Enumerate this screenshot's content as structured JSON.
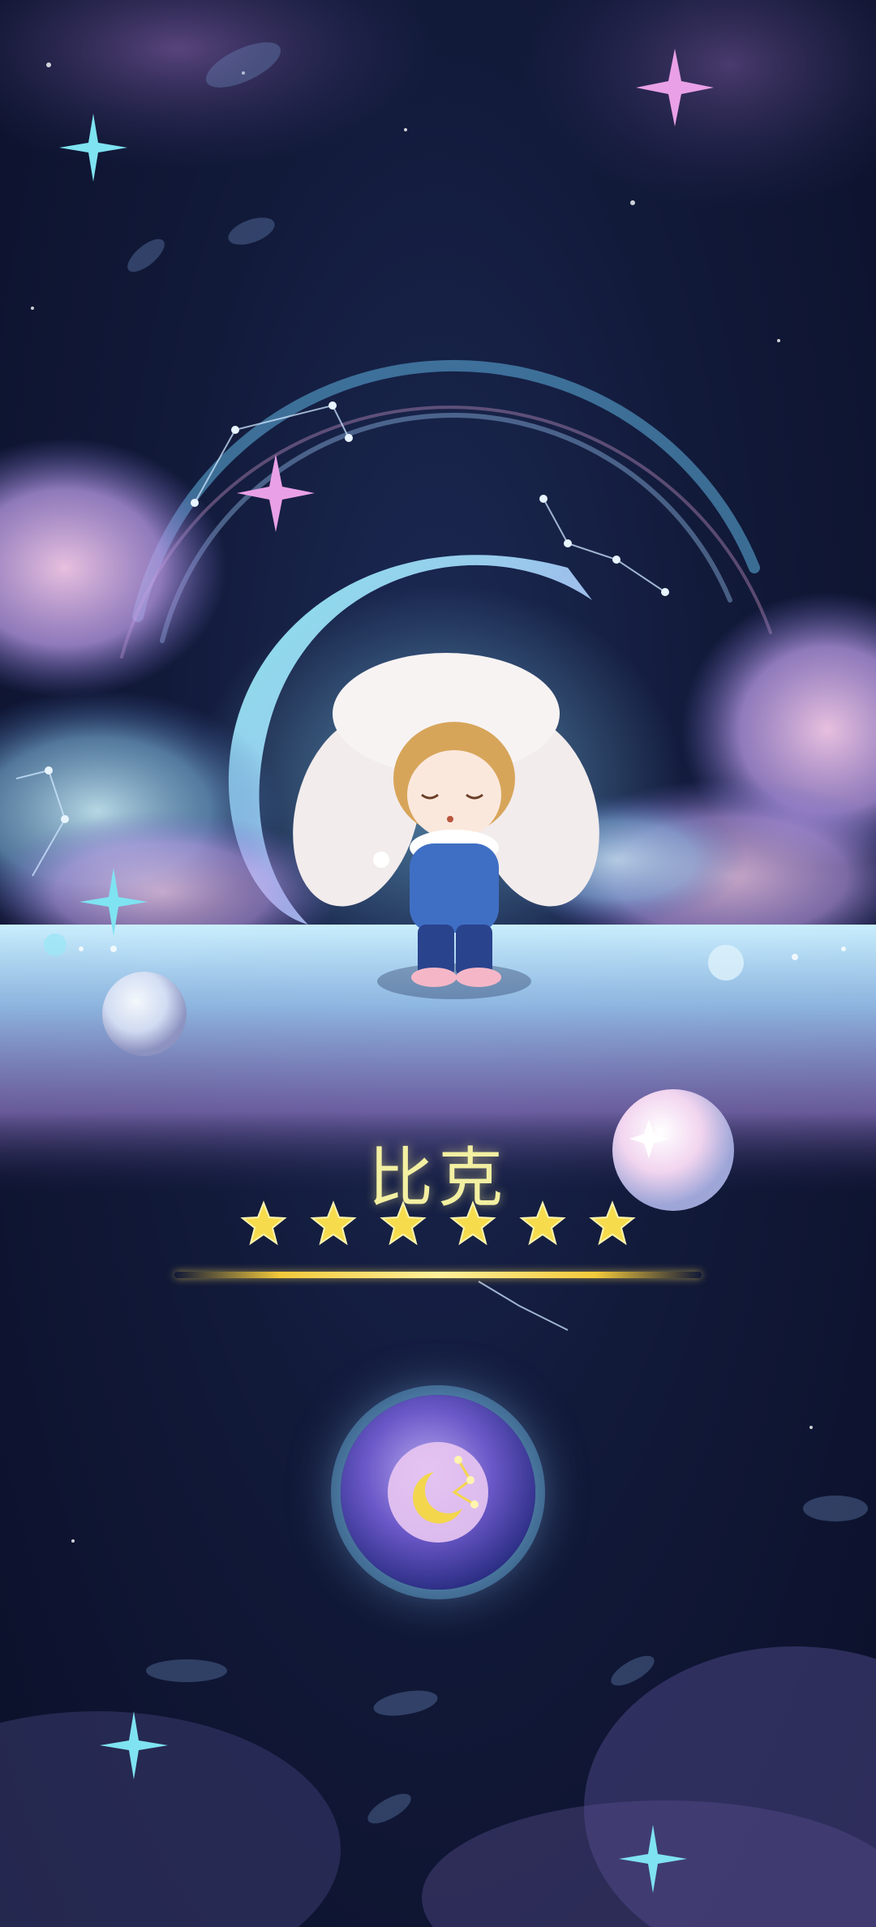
{
  "character": {
    "name": "比克",
    "star_rating": 6,
    "star_max": 6
  },
  "colors": {
    "name": "#f3f0a2",
    "star": "#f6dc4d",
    "divider": "#f3c93a",
    "background": "#121a3a"
  },
  "icons": {
    "skill": "moon-constellation-icon",
    "left_orb": "bubble-orb-icon",
    "right_orb": "star-orb-icon"
  }
}
